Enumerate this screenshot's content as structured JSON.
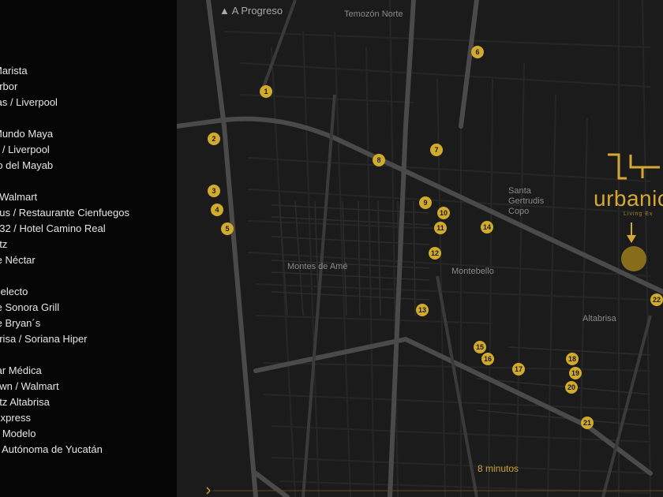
{
  "legend": {
    "items": [
      "Marista",
      "arbor",
      "ías / Liverpool",
      "Mundo Maya",
      "a / Liverpool",
      "ro del Mayab",
      "/ Walmart",
      "gus / Restaurante Cienfuegos",
      "132 / Hotel Camino Real",
      "atz",
      "te Néctar",
      "n",
      "Selecto",
      "te Sonora Grill",
      "te Bryan´s",
      "brisa / Soriana Hiper",
      "tar Médica",
      "own / Walmart",
      "atz Altabrisa",
      "Express",
      "d Modelo",
      "d Autónoma de Yucatán"
    ]
  },
  "map": {
    "direction_label": "▲ A Progreso",
    "places": {
      "temozon": "Temozón Norte",
      "santa_gertrudis": "Santa Gertrudis Copo",
      "montes_de_ame": "Montes de Amé",
      "montebello": "Montebello",
      "altabrisa": "Altabrisa"
    },
    "marker_labels": [
      "1",
      "2",
      "3",
      "4",
      "5",
      "6",
      "7",
      "8",
      "9",
      "10",
      "11",
      "12",
      "13",
      "14",
      "15",
      "16",
      "17",
      "18",
      "19",
      "20",
      "21",
      "22"
    ],
    "brand": "urbanic",
    "brand_sub": "Living Ex",
    "travel_time": "8 minutos",
    "accent_color": "#d2ab2c"
  }
}
